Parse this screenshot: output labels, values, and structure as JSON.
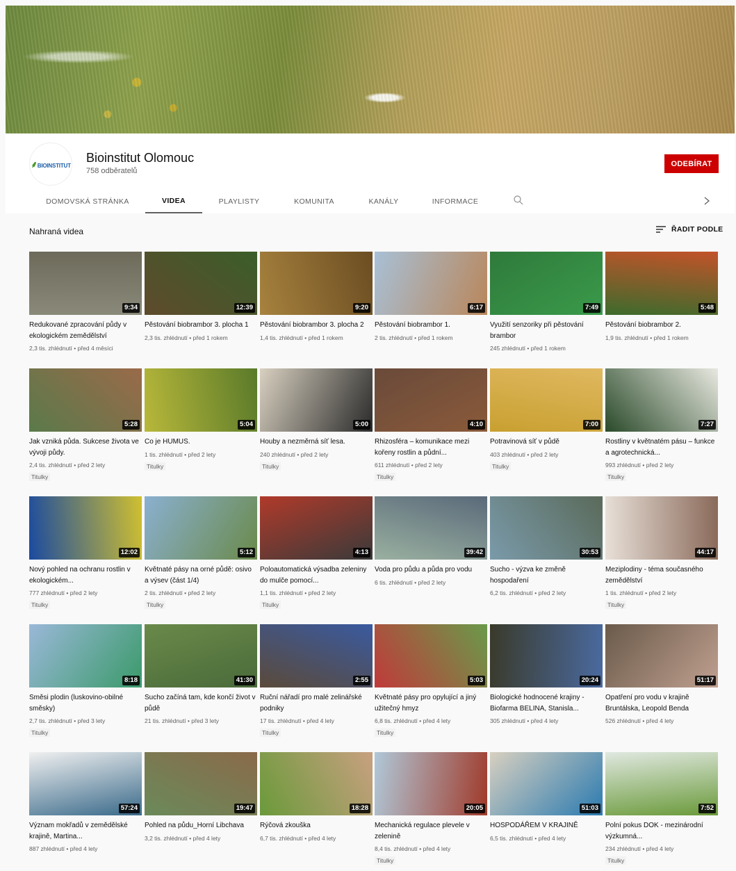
{
  "channel": {
    "name": "Bioinstitut Olomouc",
    "subscribers": "758 odběratelů",
    "logo_text": "BIOINSTITUT",
    "subscribe_label": "ODEBÍRAT"
  },
  "tabs": [
    {
      "label": "DOMOVSKÁ STRÁNKA",
      "active": false
    },
    {
      "label": "VIDEA",
      "active": true
    },
    {
      "label": "PLAYLISTY",
      "active": false
    },
    {
      "label": "KOMUNITA",
      "active": false
    },
    {
      "label": "KANÁLY",
      "active": false
    },
    {
      "label": "INFORMACE",
      "active": false
    }
  ],
  "section": {
    "title": "Nahraná videa",
    "sort_label": "ŘADIT PODLE"
  },
  "colors": {
    "subscribe": "#cc0000",
    "background": "#f9f9f9"
  },
  "videos": [
    {
      "title": "Redukované zpracování půdy v ekologickém zemědělství",
      "meta": "2,3 tis. zhlédnutí • před 4 měsíci",
      "duration": "9:34",
      "badge": "",
      "colors": [
        "#8a8a7a",
        "#6d6a5a"
      ]
    },
    {
      "title": "Pěstování biobrambor 3. plocha 1",
      "meta": "2,3 tis. zhlédnutí • před 1 rokem",
      "duration": "12:39",
      "badge": "",
      "colors": [
        "#5e4a2c",
        "#3b5e2a"
      ]
    },
    {
      "title": "Pěstování biobrambor 3. plocha 2",
      "meta": "1,4 tis. zhlédnutí • před 1 rokem",
      "duration": "9:20",
      "badge": "",
      "colors": [
        "#a7823e",
        "#6b4d22"
      ]
    },
    {
      "title": "Pěstování biobrambor 1.",
      "meta": "2 tis. zhlédnutí • před 1 rokem",
      "duration": "6:17",
      "badge": "",
      "colors": [
        "#a8c0d6",
        "#b9865a"
      ]
    },
    {
      "title": "Využití senzoriky při pěstování brambor",
      "meta": "245 zhlédnutí • před 1 rokem",
      "duration": "7:49",
      "badge": "",
      "colors": [
        "#2f7a3b",
        "#3a9a4a"
      ]
    },
    {
      "title": "Pěstování biobrambor 2.",
      "meta": "1,9 tis. zhlédnutí • před 1 rokem",
      "duration": "5:48",
      "badge": "",
      "colors": [
        "#3d6b2c",
        "#c2532a"
      ]
    },
    {
      "title": "Jak vzniká půda. Sukcese života ve vývoji půdy.",
      "meta": "2,4 tis. zhlédnutí • před 2 lety",
      "duration": "5:28",
      "badge": "Titulky",
      "colors": [
        "#5a7a4a",
        "#9a6a4a"
      ]
    },
    {
      "title": "Co je HUMUS.",
      "meta": "1 tis. zhlédnutí • před 2 lety",
      "duration": "5:04",
      "badge": "Titulky",
      "colors": [
        "#b8b83a",
        "#5a7a2a"
      ]
    },
    {
      "title": "Houby a nezměrná síť lesa.",
      "meta": "240 zhlédnutí • před 2 lety",
      "duration": "5:00",
      "badge": "Titulky",
      "colors": [
        "#d8d0c0",
        "#2a2a2a"
      ]
    },
    {
      "title": "Rhizosféra – komunikace mezi kořeny rostlin a půdní...",
      "meta": "611 zhlédnutí • před 2 lety",
      "duration": "4:10",
      "badge": "Titulky",
      "colors": [
        "#6a4a3a",
        "#8a5a3a"
      ]
    },
    {
      "title": "Potravinová síť v půdě",
      "meta": "403 zhlédnutí • před 2 lety",
      "duration": "7:00",
      "badge": "Titulky",
      "colors": [
        "#c8a030",
        "#e0b860"
      ]
    },
    {
      "title": "Rostliny v květnatém pásu – funkce a agrotechnická...",
      "meta": "993 zhlédnutí • před 2 lety",
      "duration": "7:27",
      "badge": "Titulky",
      "colors": [
        "#2a4a2a",
        "#e8e8e0"
      ]
    },
    {
      "title": "Nový pohled na ochranu rostlin v ekologickém...",
      "meta": "777 zhlédnutí • před 2 lety",
      "duration": "12:02",
      "badge": "Titulky",
      "colors": [
        "#1a4aa0",
        "#d0c030"
      ]
    },
    {
      "title": "Květnaté pásy na orné půdě: osivo a výsev (část 1/4)",
      "meta": "2 tis. zhlédnutí • před 2 lety",
      "duration": "5:12",
      "badge": "Titulky",
      "colors": [
        "#8ab0d0",
        "#6a8a4a"
      ]
    },
    {
      "title": "Poloautomatická výsadba zeleniny do mulče pomocí...",
      "meta": "1,1 tis. zhlédnutí • před 2 lety",
      "duration": "4:13",
      "badge": "Titulky",
      "colors": [
        "#b03a2a",
        "#3a3a3a"
      ]
    },
    {
      "title": "Voda pro půdu a půda pro vodu",
      "meta": "6 tis. zhlédnutí • před 2 lety",
      "duration": "39:42",
      "badge": "",
      "colors": [
        "#9ab0a0",
        "#5a6a7a"
      ]
    },
    {
      "title": "Sucho - výzva ke změně hospodaření",
      "meta": "6,2 tis. zhlédnutí • před 2 lety",
      "duration": "30:53",
      "badge": "",
      "colors": [
        "#7a9aaa",
        "#5a6a5a"
      ]
    },
    {
      "title": "Meziplodiny - téma současného zemědělství",
      "meta": "1 tis. zhlédnutí • před 2 lety",
      "duration": "44:17",
      "badge": "Titulky",
      "colors": [
        "#e8e0d8",
        "#8a6a5a"
      ]
    },
    {
      "title": "Směsi plodin (luskovino-obilné směsky)",
      "meta": "2,7 tis. zhlédnutí • před 3 lety",
      "duration": "8:18",
      "badge": "Titulky",
      "colors": [
        "#9ab8d8",
        "#3a9a6a"
      ]
    },
    {
      "title": "Sucho začíná tam, kde končí život v půdě",
      "meta": "21 tis. zhlédnutí • před 3 lety",
      "duration": "41:30",
      "badge": "",
      "colors": [
        "#6a8a4a",
        "#4a6a3a"
      ]
    },
    {
      "title": "Ruční nářadí pro malé zelinářské podniky",
      "meta": "17 tis. zhlédnutí • před 4 lety",
      "duration": "2:55",
      "badge": "Titulky",
      "colors": [
        "#5a4a3a",
        "#3a5aa0"
      ]
    },
    {
      "title": "Květnaté pásy pro opylující a jiný užitečný hmyz",
      "meta": "6,8 tis. zhlédnutí • před 4 lety",
      "duration": "5:03",
      "badge": "Titulky",
      "colors": [
        "#c03a3a",
        "#6a9a4a"
      ]
    },
    {
      "title": "Biologické hodnocené krajiny - Biofarma BELINA, Stanisla...",
      "meta": "305 zhlédnutí • před 4 lety",
      "duration": "20:24",
      "badge": "",
      "colors": [
        "#3a3a2a",
        "#4a6aa0"
      ]
    },
    {
      "title": "Opatření pro vodu v krajině Bruntálska, Leopold Benda",
      "meta": "526 zhlédnutí • před 4 lety",
      "duration": "51:17",
      "badge": "",
      "colors": [
        "#6a5a4a",
        "#c0a090"
      ]
    },
    {
      "title": "Význam mokřadů v zemědělské krajině, Martina...",
      "meta": "887 zhlédnutí • před 4 lety",
      "duration": "57:24",
      "badge": "",
      "colors": [
        "#f0f0f0",
        "#3a6a8a"
      ]
    },
    {
      "title": "Pohled na půdu_Horní Libchava",
      "meta": "3,2 tis. zhlédnutí • před 4 lety",
      "duration": "19:47",
      "badge": "",
      "colors": [
        "#6a8a5a",
        "#8a6a4a"
      ]
    },
    {
      "title": "Rýčová zkouška",
      "meta": "6,7 tis. zhlédnutí • před 4 lety",
      "duration": "18:28",
      "badge": "",
      "colors": [
        "#6a9a3a",
        "#c8a080"
      ]
    },
    {
      "title": "Mechanická regulace plevele v zelenině",
      "meta": "8,4 tis. zhlédnutí • před 4 lety",
      "duration": "20:05",
      "badge": "Titulky",
      "colors": [
        "#b0c8d8",
        "#a03a2a"
      ]
    },
    {
      "title": "HOSPODÁŘEM V KRAJINĚ",
      "meta": "6,5 tis. zhlédnutí • před 4 lety",
      "duration": "51:03",
      "badge": "",
      "colors": [
        "#d8d0c0",
        "#2a7ab0"
      ]
    },
    {
      "title": "Polní pokus DOK - mezinárodní výzkumná...",
      "meta": "234 zhlédnutí • před 4 lety",
      "duration": "7:52",
      "badge": "Titulky",
      "colors": [
        "#e0e8e0",
        "#6a9a3a"
      ]
    }
  ]
}
